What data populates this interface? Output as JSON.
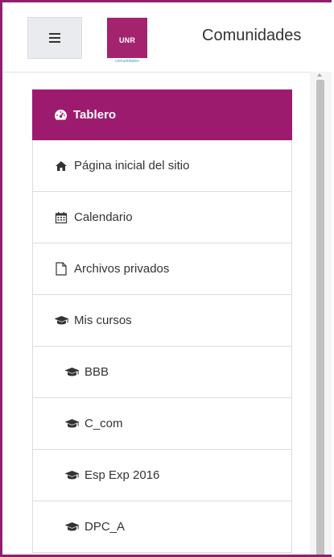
{
  "header": {
    "menu_icon": "hamburger-icon",
    "logo": {
      "main": "UNR",
      "sub": "comunidades"
    },
    "site_title": "Comunidades"
  },
  "nav": {
    "items": [
      {
        "label": "Tablero",
        "icon": "dashboard-icon",
        "active": true
      },
      {
        "label": "Página inicial del sitio",
        "icon": "home-icon"
      },
      {
        "label": "Calendario",
        "icon": "calendar-icon"
      },
      {
        "label": "Archivos privados",
        "icon": "file-icon"
      },
      {
        "label": "Mis cursos",
        "icon": "graduation-cap-icon"
      },
      {
        "label": "BBB",
        "icon": "graduation-cap-icon"
      },
      {
        "label": "C_com",
        "icon": "graduation-cap-icon"
      },
      {
        "label": "Esp Exp 2016",
        "icon": "graduation-cap-icon"
      },
      {
        "label": "DPC_A",
        "icon": "graduation-cap-icon"
      }
    ]
  },
  "colors": {
    "accent": "#9c1b6f",
    "frame": "#8e1f6f",
    "logo_bg": "#a3236f",
    "logo_sub": "#2fa4c8"
  }
}
